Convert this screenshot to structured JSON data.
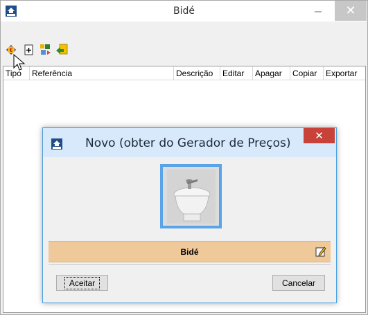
{
  "window": {
    "title": "Bidé",
    "icon": "mep-app-icon"
  },
  "toolbar": {
    "buttons": [
      {
        "name": "euro-price-icon"
      },
      {
        "name": "add-icon"
      },
      {
        "name": "import-icon"
      },
      {
        "name": "export-icon"
      }
    ]
  },
  "table": {
    "columns": [
      "Tipo",
      "Referência",
      "Descrição",
      "Editar",
      "Apagar",
      "Copiar",
      "Exportar"
    ]
  },
  "dialog": {
    "title": "Novo (obter do Gerador de Preços)",
    "item_name": "Bidé",
    "ok_label": "Aceitar",
    "cancel_label": "Cancelar"
  },
  "colors": {
    "accent": "#59a4e8",
    "name_bar": "#efc99a",
    "close_red": "#c8423a"
  }
}
